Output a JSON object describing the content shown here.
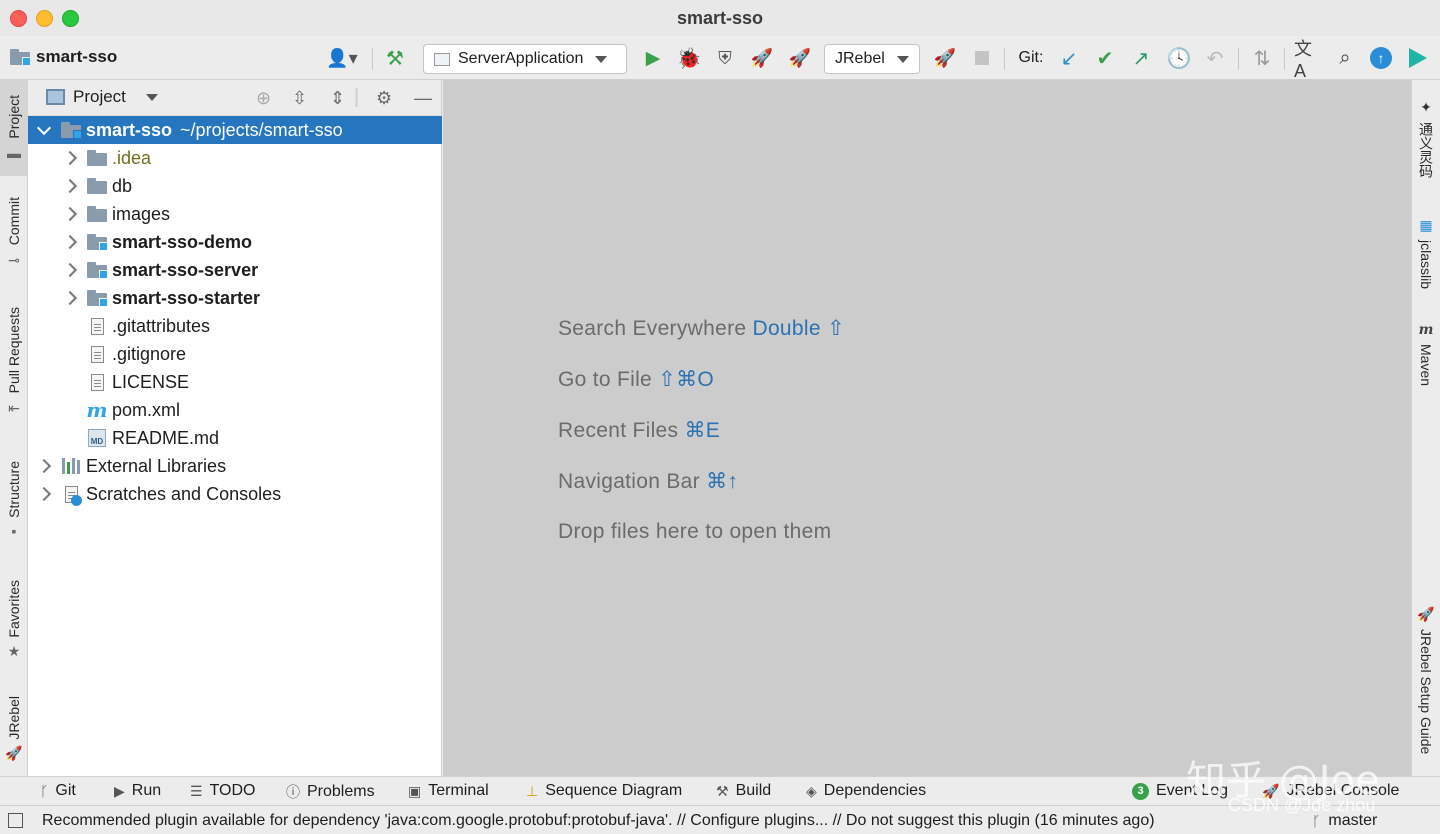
{
  "window": {
    "title": "smart-sso"
  },
  "toolbar": {
    "project_name": "smart-sso",
    "run_config": "ServerApplication",
    "jrebel_config": "JRebel",
    "git_label": "Git:"
  },
  "left_strip": [
    "Project",
    "Commit",
    "Pull Requests",
    "Structure",
    "Favorites",
    "JRebel"
  ],
  "right_strip": [
    "通义灵码",
    "jclasslib",
    "Maven",
    "JRebel Setup Guide"
  ],
  "panel": {
    "title": "Project",
    "root_name": "smart-sso",
    "root_path": "~/projects/smart-sso",
    "items": [
      {
        "label": ".idea"
      },
      {
        "label": "db"
      },
      {
        "label": "images"
      },
      {
        "label": "smart-sso-demo"
      },
      {
        "label": "smart-sso-server"
      },
      {
        "label": "smart-sso-starter"
      },
      {
        "label": ".gitattributes"
      },
      {
        "label": ".gitignore"
      },
      {
        "label": "LICENSE"
      },
      {
        "label": "pom.xml"
      },
      {
        "label": "README.md"
      },
      {
        "label": "External Libraries"
      },
      {
        "label": "Scratches and Consoles"
      }
    ]
  },
  "editor": {
    "hints": [
      {
        "text": "Search Everywhere ",
        "key": "Double ⇧"
      },
      {
        "text": "Go to File ",
        "key": "⇧⌘O"
      },
      {
        "text": "Recent Files ",
        "key": "⌘E"
      },
      {
        "text": "Navigation Bar ",
        "key": "⌘↑"
      },
      {
        "text": "Drop files here to open them",
        "key": ""
      }
    ]
  },
  "bottom_tabs": [
    "Git",
    "Run",
    "TODO",
    "Problems",
    "Terminal",
    "Sequence Diagram",
    "Build",
    "Dependencies"
  ],
  "event_log": {
    "count": "3",
    "label": "Event Log"
  },
  "jrebel_console": "JRebel Console",
  "status": {
    "message": "Recommended plugin available for dependency 'java:com.google.protobuf:protobuf-java'. // Configure plugins... // Do not suggest this plugin (16 minutes ago)",
    "branch": "master"
  },
  "watermark": {
    "main": "知乎 @Joe",
    "sub": "CSDN @Joe zhou"
  },
  "colors": {
    "selection": "#2675bf",
    "accent": "#2b72b5",
    "run_green": "#3aa04a"
  }
}
